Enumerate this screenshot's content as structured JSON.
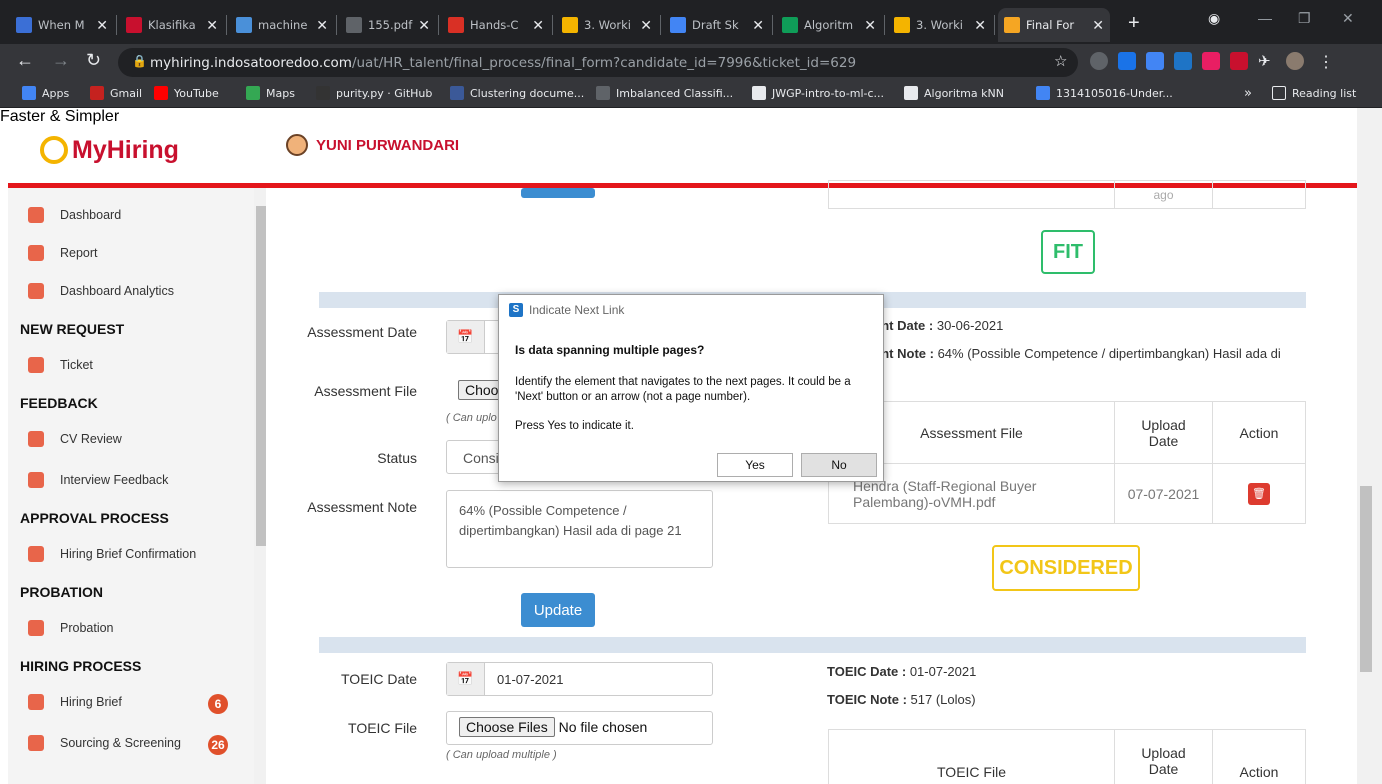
{
  "browser": {
    "tabs": [
      {
        "title": "When M",
        "icon_color": "#3b6fd6"
      },
      {
        "title": "Klasifika",
        "icon_color": "#c8102e"
      },
      {
        "title": "machine",
        "icon_color": "#4a90d9"
      },
      {
        "title": "155.pdf",
        "icon_color": "#5f6368"
      },
      {
        "title": "Hands-C",
        "icon_color": "#d93025"
      },
      {
        "title": "3. Worki",
        "icon_color": "#f4b400"
      },
      {
        "title": "Draft Sk",
        "icon_color": "#4285f4"
      },
      {
        "title": "Algoritm",
        "icon_color": "#0f9d58"
      },
      {
        "title": "3. Worki",
        "icon_color": "#f4b400"
      },
      {
        "title": "Final For",
        "icon_color": "#f5a623"
      }
    ],
    "new_tab": "+",
    "url_domain": "myhiring.indosatooredoo.com",
    "url_path": "/uat/HR_talent/final_process/final_form?candidate_id=7996&ticket_id=629",
    "bookmarks": [
      "Apps",
      "Gmail",
      "YouTube",
      "Maps",
      "purity.py · GitHub",
      "Clustering docume...",
      "Imbalanced Classifi...",
      "JWGP-intro-to-ml-c...",
      "Algoritma kNN",
      "1314105016-Under..."
    ],
    "bookmark_overflow": "»",
    "reading_list": "Reading list"
  },
  "header": {
    "logo_text": "MyHiring",
    "logo_tagline": "Faster & Simpler",
    "user_name": "YUNI PURWANDARI"
  },
  "sidebar": {
    "items": [
      {
        "type": "item",
        "label": "Dashboard",
        "icon": "dashboard-icon",
        "color": "#e8654a"
      },
      {
        "type": "item",
        "label": "Report",
        "icon": "report-icon",
        "color": "#e8654a"
      },
      {
        "type": "item",
        "label": "Dashboard Analytics",
        "icon": "analytics-icon",
        "color": "#e8654a"
      },
      {
        "type": "section",
        "label": "NEW REQUEST"
      },
      {
        "type": "item",
        "label": "Ticket",
        "icon": "ticket-icon",
        "color": "#e8654a"
      },
      {
        "type": "section",
        "label": "FEEDBACK"
      },
      {
        "type": "item",
        "label": "CV Review",
        "icon": "cv-review-icon",
        "color": "#e8654a"
      },
      {
        "type": "item",
        "label": "Interview Feedback",
        "icon": "interview-icon",
        "color": "#e8654a"
      },
      {
        "type": "section",
        "label": "APPROVAL PROCESS"
      },
      {
        "type": "item",
        "label": "Hiring Brief Confirmation",
        "icon": "thumbs-up-icon",
        "color": "#e8654a"
      },
      {
        "type": "section",
        "label": "PROBATION"
      },
      {
        "type": "item",
        "label": "Probation",
        "icon": "funnel-icon",
        "color": "#e8654a"
      },
      {
        "type": "section",
        "label": "HIRING PROCESS"
      },
      {
        "type": "item",
        "label": "Hiring Brief",
        "icon": "hiring-brief-icon",
        "color": "#e8654a",
        "badge": "6"
      },
      {
        "type": "item",
        "label": "Sourcing & Screening",
        "icon": "sourcing-icon",
        "color": "#e8654a",
        "badge": "26"
      }
    ]
  },
  "assessment": {
    "tag_fit": "FIT",
    "top_table_cell": "ago",
    "date_label": "Assessment Date",
    "file_label": "Assessment File",
    "choose_btn": "Choo",
    "upload_hint": "( Can uplo",
    "status_label": "Status",
    "status_value": "Consi",
    "note_label": "Assessment Note",
    "note_value": "64% (Possible Competence / dipertimbangkan) Hasil ada di page 21",
    "update_btn": "Update",
    "info_date_label": "ent Date :",
    "info_date_value": " 30-06-2021",
    "info_note_label": "ent Note :",
    "info_note_value": " 64% (Possible Competence / dipertimbangkan) Hasil ada di",
    "table_headers": [
      "Assessment File",
      "Upload Date",
      "Action"
    ],
    "table_row": {
      "file": "Hendra (Staff-Regional Buyer Palembang)-oVMH.pdf",
      "date": "07-07-2021"
    },
    "tag_considered": "CONSIDERED"
  },
  "toeic": {
    "date_label": "TOEIC Date",
    "date_value": "01-07-2021",
    "file_label": "TOEIC File",
    "choose_btn": "Choose Files",
    "no_file": "No file chosen",
    "upload_hint": "( Can upload multiple )",
    "info_date_label": "TOEIC Date :",
    "info_date_value": " 01-07-2021",
    "info_note_label": "TOEIC Note :",
    "info_note_value": " 517 (Lolos)",
    "table_headers": [
      "TOEIC File",
      "Upload Date",
      "Action"
    ]
  },
  "dialog": {
    "title": "Indicate Next Link",
    "question": "Is data spanning multiple pages?",
    "body1": "Identify the element that navigates to the next pages. It could be a 'Next' button or an arrow (not a page number).",
    "body2": "Press Yes to indicate it.",
    "yes": "Yes",
    "no": "No"
  }
}
